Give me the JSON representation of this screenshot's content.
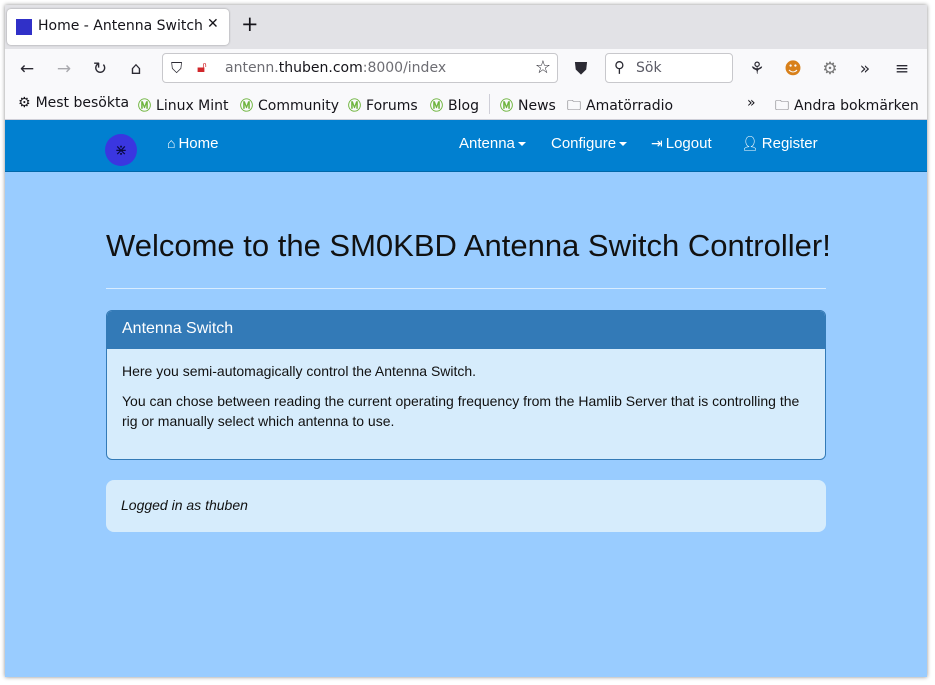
{
  "browser": {
    "tab_title": "Home - Antenna Switch",
    "url_prefix": "antenn.",
    "url_host": "thuben.com",
    "url_suffix": ":8000/index",
    "search_placeholder": "Sök",
    "bookmarks": [
      {
        "label": "Mest besökta",
        "icon": "gear-icon"
      },
      {
        "label": "Linux Mint",
        "icon": "mint-icon"
      },
      {
        "label": "Community",
        "icon": "mint-icon"
      },
      {
        "label": "Forums",
        "icon": "mint-icon"
      },
      {
        "label": "Blog",
        "icon": "mint-icon"
      },
      {
        "label": "News",
        "icon": "mint-icon"
      },
      {
        "label": "Amatörradio",
        "icon": "folder-icon"
      }
    ],
    "other_bookmarks": "Andra bokmärken"
  },
  "site_nav": {
    "home": "Home",
    "antenna": "Antenna",
    "configure": "Configure",
    "logout": "Logout",
    "register": "Register"
  },
  "main": {
    "heading": "Welcome to the SM0KBD Antenna Switch Controller!",
    "panel_title": "Antenna Switch",
    "panel_p1": "Here you semi-automagically control the Antenna Switch.",
    "panel_p2": "You can chose between reading the current operating frequency from the Hamlib Server that is controlling the rig or manually select which antenna to use.",
    "logged_in": "Logged in as thuben"
  },
  "colors": {
    "page_bg": "#99ccff",
    "navbar": "#0180d0",
    "panel_heading": "#337ab7"
  }
}
